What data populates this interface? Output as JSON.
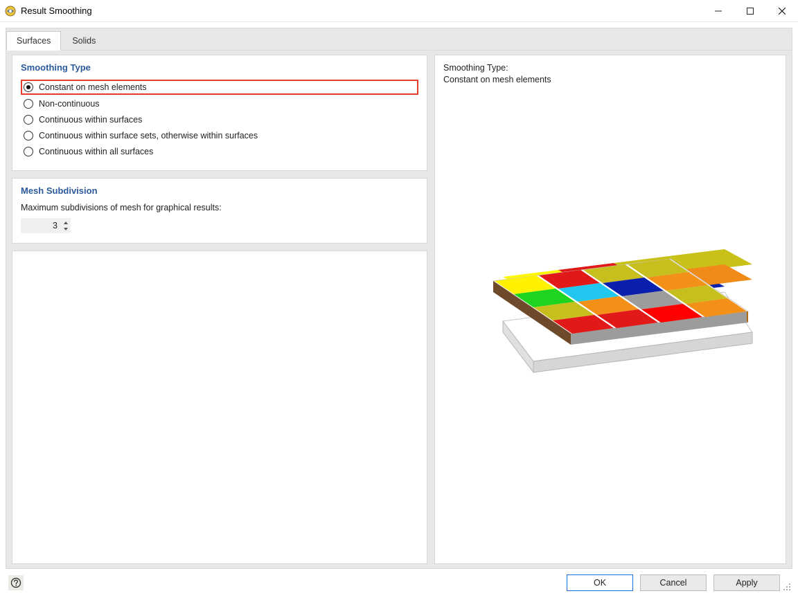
{
  "window": {
    "title": "Result Smoothing"
  },
  "tabs": [
    {
      "label": "Surfaces",
      "active": true
    },
    {
      "label": "Solids",
      "active": false
    }
  ],
  "smoothing": {
    "title": "Smoothing Type",
    "options": [
      "Constant on mesh elements",
      "Non-continuous",
      "Continuous within surfaces",
      "Continuous within surface sets, otherwise within surfaces",
      "Continuous within all surfaces"
    ],
    "selected_index": 0
  },
  "mesh": {
    "title": "Mesh Subdivision",
    "label": "Maximum subdivisions of mesh for graphical results:",
    "value": "3"
  },
  "preview": {
    "line1": "Smoothing Type:",
    "line2": "Constant on mesh elements"
  },
  "buttons": {
    "ok": "OK",
    "cancel": "Cancel",
    "apply": "Apply"
  }
}
